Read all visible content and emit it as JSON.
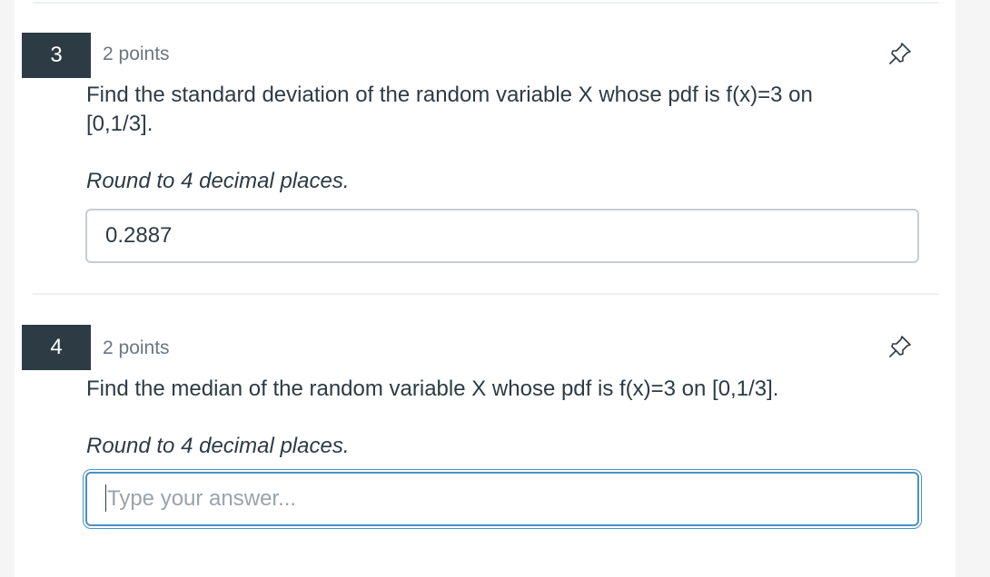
{
  "questions": [
    {
      "number": "3",
      "points": "2 points",
      "text": "Find the standard deviation of the random variable X whose pdf is f(x)=3 on [0,1/3].",
      "instruction": "Round to 4 decimal places.",
      "answer": "0.2887",
      "pin_icon": "pushpin-icon"
    },
    {
      "number": "4",
      "points": "2 points",
      "text": "Find the median of the random variable X whose pdf is f(x)=3 on [0,1/3].",
      "instruction": "Round to 4 decimal places.",
      "answer": "",
      "placeholder": "Type your answer...",
      "pin_icon": "pushpin-icon"
    }
  ],
  "colors": {
    "badge_bg": "#2d3b45",
    "text": "#2d3b45",
    "muted": "#6b7780",
    "focus": "#4a90c8"
  }
}
